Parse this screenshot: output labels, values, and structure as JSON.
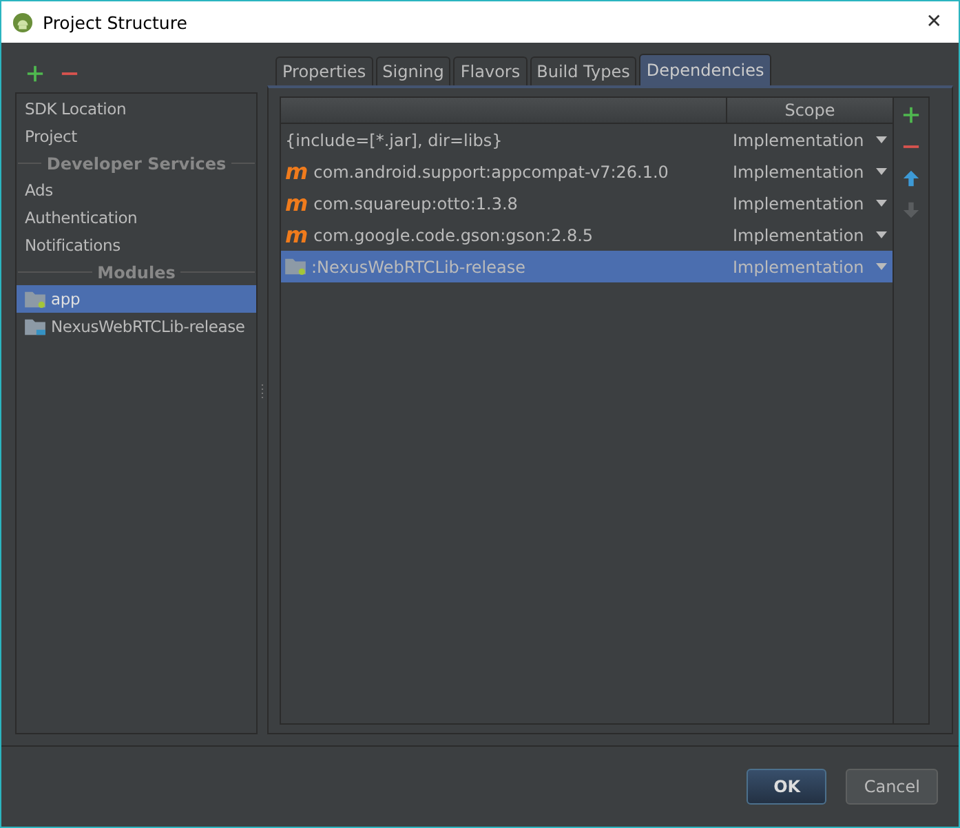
{
  "window": {
    "title": "Project Structure",
    "close": "✕"
  },
  "sidebar": {
    "items": [
      {
        "kind": "item",
        "label": "SDK Location",
        "selected": false
      },
      {
        "kind": "item",
        "label": "Project",
        "selected": false
      },
      {
        "kind": "header",
        "label": "Developer Services"
      },
      {
        "kind": "item",
        "label": "Ads",
        "selected": false
      },
      {
        "kind": "item",
        "label": "Authentication",
        "selected": false
      },
      {
        "kind": "item",
        "label": "Notifications",
        "selected": false
      },
      {
        "kind": "header",
        "label": "Modules"
      },
      {
        "kind": "app-module",
        "label": "app",
        "selected": true
      },
      {
        "kind": "lib-module",
        "label": "NexusWebRTCLib-release",
        "selected": false
      }
    ]
  },
  "tabs": [
    {
      "label": "Properties",
      "selected": false
    },
    {
      "label": "Signing",
      "selected": false
    },
    {
      "label": "Flavors",
      "selected": false
    },
    {
      "label": "Build Types",
      "selected": false
    },
    {
      "label": "Dependencies",
      "selected": true
    }
  ],
  "table": {
    "columns": [
      "Scope"
    ],
    "rows": [
      {
        "kind": "jar",
        "name": "{include=[*.jar], dir=libs}",
        "scope": "Implementation",
        "selected": false
      },
      {
        "kind": "maven",
        "badge": "m",
        "name": "com.android.support:appcompat-v7:26.1.0",
        "scope": "Implementation",
        "selected": false
      },
      {
        "kind": "maven",
        "badge": "m",
        "name": "com.squareup:otto:1.3.8",
        "scope": "Implementation",
        "selected": false
      },
      {
        "kind": "maven",
        "badge": "m",
        "name": "com.google.code.gson:gson:2.8.5",
        "scope": "Implementation",
        "selected": false
      },
      {
        "kind": "module",
        "name": ":NexusWebRTCLib-release",
        "scope": "Implementation",
        "selected": true
      }
    ]
  },
  "buttons": [
    {
      "label": "OK",
      "kind": "primary"
    },
    {
      "label": "Cancel",
      "kind": "secondary"
    }
  ]
}
